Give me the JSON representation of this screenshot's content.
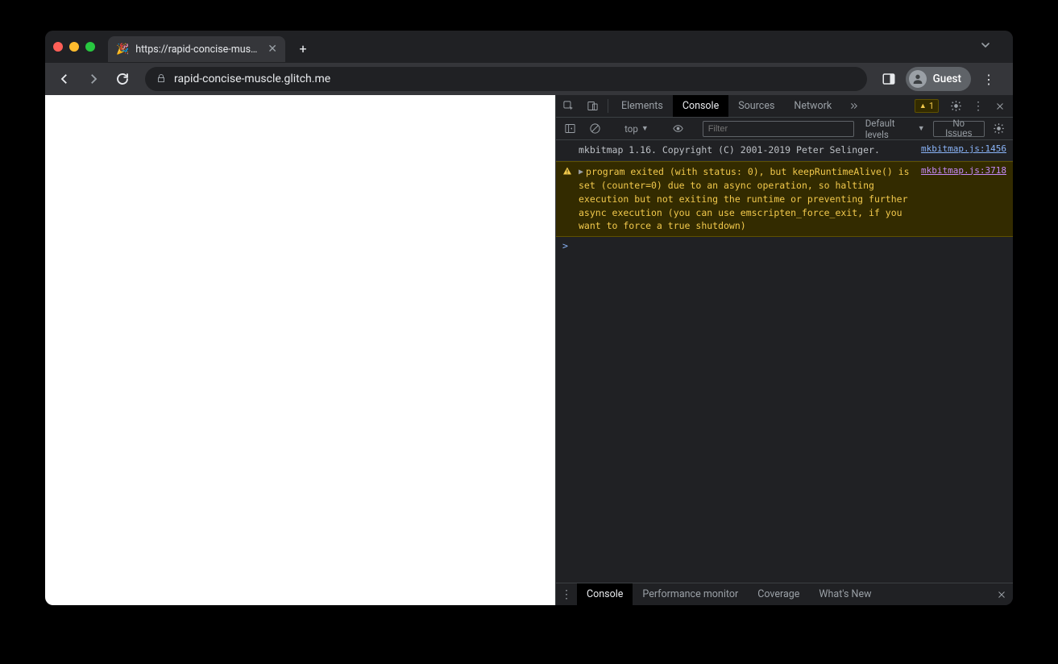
{
  "tab": {
    "favicon": "🎉",
    "title": "https://rapid-concise-muscle.g"
  },
  "address": {
    "url": "rapid-concise-muscle.glitch.me"
  },
  "profile": {
    "label": "Guest"
  },
  "devtools": {
    "tabs": {
      "elements": "Elements",
      "console": "Console",
      "sources": "Sources",
      "network": "Network"
    },
    "warning_count": "1",
    "toolbar": {
      "context": "top",
      "filter_placeholder": "Filter",
      "levels": "Default levels",
      "issues": "No Issues"
    },
    "messages": {
      "log0": {
        "text": "mkbitmap 1.16. Copyright (C) 2001-2019 Peter Selinger.",
        "src": "mkbitmap.js:1456"
      },
      "warn0": {
        "text": "program exited (with status: 0), but keepRuntimeAlive() is set (counter=0) due to an async operation, so halting execution but not exiting the runtime or preventing further async execution (you can use emscripten_force_exit, if you want to force a true shutdown)",
        "src": "mkbitmap.js:3718"
      }
    },
    "prompt": ">",
    "drawer": {
      "console": "Console",
      "perfmon": "Performance monitor",
      "coverage": "Coverage",
      "whatsnew": "What's New"
    }
  }
}
